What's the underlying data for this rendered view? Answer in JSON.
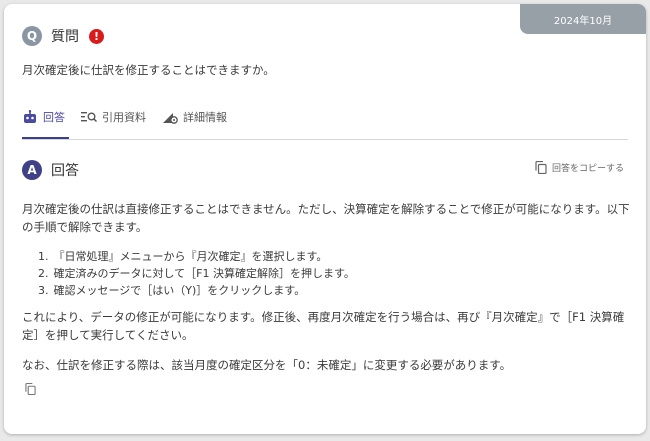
{
  "date_badge": "2024年10月",
  "question": {
    "icon_letter": "Q",
    "title": "質問",
    "alert_icon": "exclamation-icon",
    "text": "月次確定後に仕訳を修正することはできますか。"
  },
  "tabs": [
    {
      "label": "回答",
      "icon": "robot-icon",
      "active": true
    },
    {
      "label": "引用資料",
      "icon": "list-search-icon",
      "active": false
    },
    {
      "label": "詳細情報",
      "icon": "settings-detail-icon",
      "active": false
    }
  ],
  "answer": {
    "icon_letter": "A",
    "title": "回答",
    "copy_label": "回答をコピーする",
    "paragraph1": "月次確定後の仕訳は直接修正することはできません。ただし、決算確定を解除することで修正が可能になります。以下の手順で解除できます。",
    "steps": [
      "『日常処理』メニューから『月次確定』を選択します。",
      "確定済みのデータに対して［F1 決算確定解除］を押します。",
      "確認メッセージで［はい（Y)］をクリックします。"
    ],
    "paragraph2": "これにより、データの修正が可能になります。修正後、再度月次確定を行う場合は、再び『月次確定』で［F1 決算確定］を押して実行してください。",
    "paragraph3": "なお、仕訳を修正する際は、該当月度の確定区分を「0：未確定」に変更する必要があります。"
  },
  "colors": {
    "accent": "#3e4187",
    "alert": "#d81b1b",
    "badge": "#97a0a7"
  }
}
